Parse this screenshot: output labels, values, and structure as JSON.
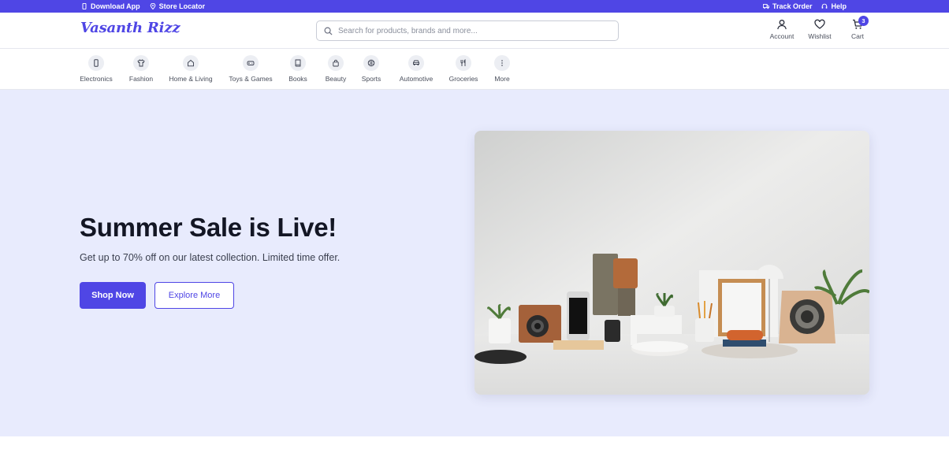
{
  "topbar": {
    "download_app": "Download App",
    "store_locator": "Store Locator",
    "track_order": "Track Order",
    "help": "Help"
  },
  "header": {
    "logo": "Vasanth Rizz",
    "search_placeholder": "Search for products, brands and more...",
    "account": "Account",
    "wishlist": "Wishlist",
    "cart": "Cart",
    "cart_count": "3"
  },
  "categories": [
    {
      "label": "Electronics",
      "icon": "phone-icon"
    },
    {
      "label": "Fashion",
      "icon": "shirt-icon"
    },
    {
      "label": "Home & Living",
      "icon": "home-icon"
    },
    {
      "label": "Toys & Games",
      "icon": "gamepad-icon"
    },
    {
      "label": "Books",
      "icon": "book-icon"
    },
    {
      "label": "Beauty",
      "icon": "bag-icon"
    },
    {
      "label": "Sports",
      "icon": "ball-icon"
    },
    {
      "label": "Automotive",
      "icon": "car-icon"
    },
    {
      "label": "Groceries",
      "icon": "utensils-icon"
    },
    {
      "label": "More",
      "icon": "more-icon"
    }
  ],
  "hero": {
    "title": "Summer Sale is Live!",
    "subtitle": "Get up to 70% off on our latest collection. Limited time offer.",
    "shop_now": "Shop Now",
    "explore_more": "Explore More"
  },
  "colors": {
    "brand": "#4f46e5",
    "hero_bg": "#e8ebfd"
  }
}
